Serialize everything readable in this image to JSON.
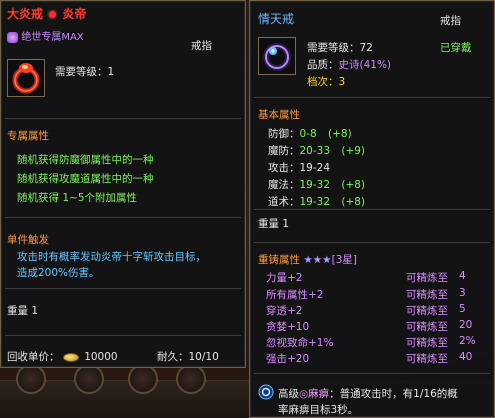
{
  "left": {
    "title": "大炎戒",
    "title_sep": "炎帝",
    "badge_text": "绝世专属MAX",
    "item_type": "戒指",
    "required_level": "需要等级：1",
    "section_exclusive": "专属属性",
    "exclusive_lines": [
      "随机获得防魔御属性中的一种",
      "随机获得攻魔道属性中的一种",
      "随机获得 1~5个附加属性"
    ],
    "section_trigger": "单件触发",
    "trigger_lines": [
      "攻击时有概率发动炎帝十字斩攻击目标，",
      "造成200%伤害。"
    ],
    "weight": "重量 1",
    "recycle_label": "回收单价：",
    "recycle_value": "10000",
    "durability": "耐久：10/10"
  },
  "right": {
    "title": "情天戒",
    "item_type": "戒指",
    "required_level": "需要等级：72",
    "equipped": "已穿戴",
    "quality_label": "品质：",
    "quality_value": "史诗(41%)",
    "grade": "档次：3",
    "section_base": "基本属性",
    "base_stats": [
      {
        "label": "防御：",
        "value": "0-8",
        "bonus": "(+8)"
      },
      {
        "label": "魔防：",
        "value": "20-33",
        "bonus": "(+9)"
      },
      {
        "label": "攻击：",
        "value": "19-24",
        "bonus": ""
      },
      {
        "label": "魔法：",
        "value": "19-32",
        "bonus": "(+8)"
      },
      {
        "label": "道术：",
        "value": "19-32",
        "bonus": "(+8)"
      }
    ],
    "weight": "重量 1",
    "section_refine": "重铸属性",
    "refine_stars": "★★★",
    "refine_star_text": "[3星]",
    "refine_stats": [
      {
        "label": "力量+2",
        "status": "可精炼至",
        "max": "4"
      },
      {
        "label": "所有属性+2",
        "status": "可精炼至",
        "max": "3"
      },
      {
        "label": "穿透+2",
        "status": "可精炼至",
        "max": "5"
      },
      {
        "label": "贪婪+10",
        "status": "可精炼至",
        "max": "20"
      },
      {
        "label": "忽视致命+1%",
        "status": "可精炼至",
        "max": "2%"
      },
      {
        "label": "强击+20",
        "status": "可精炼至",
        "max": "40"
      }
    ],
    "skill_line1": "高级",
    "skill_name": "◎麻痹",
    "skill_desc1": "：普通攻击时，有1/16的概",
    "skill_desc2": "率麻痹目标3秒。"
  },
  "colors": {
    "title_red": "#ff3b2f",
    "title_blue": "#6fb8ff",
    "equipped_green": "#7ef35c",
    "quality_purple": "#c98bff",
    "section_orange": "#ff9a3c",
    "trigger_cyan": "#66c7ff",
    "refine_violet": "#d58cff"
  }
}
